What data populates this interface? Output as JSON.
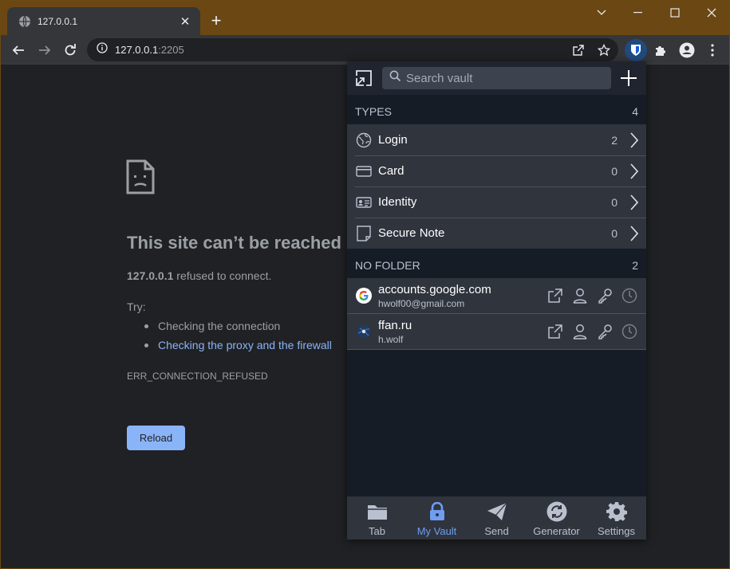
{
  "browser": {
    "tab": {
      "title": "127.0.0.1",
      "close_label": "✕"
    },
    "new_tab_label": "+",
    "address": {
      "host": "127.0.0.1",
      "port": ":2205"
    }
  },
  "error_page": {
    "title": "This site can’t be reached",
    "host": "127.0.0.1",
    "message": " refused to connect.",
    "try_label": "Try:",
    "suggestions": [
      {
        "text": "Checking the connection",
        "link": false
      },
      {
        "text": "Checking the proxy and the firewall",
        "link": true
      }
    ],
    "error_code": "ERR_CONNECTION_REFUSED",
    "reload_label": "Reload"
  },
  "vault": {
    "search": {
      "placeholder": "Search vault"
    },
    "types_section": {
      "title": "TYPES",
      "count": "4"
    },
    "types": [
      {
        "label": "Login",
        "count": "2",
        "icon": "globe-icon"
      },
      {
        "label": "Card",
        "count": "0",
        "icon": "credit-card-icon"
      },
      {
        "label": "Identity",
        "count": "0",
        "icon": "id-card-icon"
      },
      {
        "label": "Secure Note",
        "count": "0",
        "icon": "sticky-note-icon"
      }
    ],
    "folder_section": {
      "title": "NO FOLDER",
      "count": "2"
    },
    "items": [
      {
        "name": "accounts.google.com",
        "username": "hwolf00@gmail.com",
        "icon": "google-favicon"
      },
      {
        "name": "ffan.ru",
        "username": "h.wolf",
        "icon": "ffan-favicon"
      }
    ],
    "nav": [
      {
        "label": "Tab",
        "icon": "folder-icon",
        "active": false
      },
      {
        "label": "My Vault",
        "icon": "lock-icon",
        "active": true
      },
      {
        "label": "Send",
        "icon": "paper-plane-icon",
        "active": false
      },
      {
        "label": "Generator",
        "icon": "refresh-icon",
        "active": false
      },
      {
        "label": "Settings",
        "icon": "gear-icon",
        "active": false
      }
    ]
  },
  "colors": {
    "titlebar": "#6b4714",
    "toolbar": "#35363a",
    "page_bg": "#202124",
    "link": "#8ab4f8",
    "popup_bg": "#161c26",
    "popup_row": "#2f343d",
    "active_nav": "#6f9df1"
  }
}
